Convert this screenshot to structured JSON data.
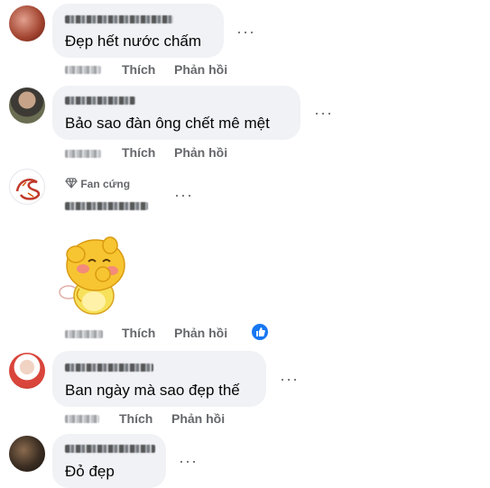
{
  "actions": {
    "like": "Thích",
    "reply": "Phản hồi"
  },
  "comments": [
    {
      "text": "Đẹp hết nước chấm"
    },
    {
      "text": "Bảo sao đàn ông chết mê mệt"
    },
    {
      "badge": "Fan cứng",
      "sticker": "qoobee-blushing-sticker",
      "reaction": "like"
    },
    {
      "text": "Ban ngày mà sao đẹp thế"
    },
    {
      "text": "Đỏ đẹp"
    }
  ],
  "colors": {
    "bubble": "#f0f2f5",
    "action_text": "#65676b",
    "like_blue": "#1877f2"
  }
}
